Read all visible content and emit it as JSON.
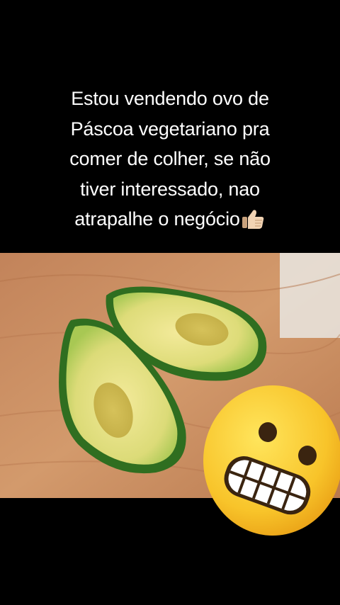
{
  "caption": {
    "line1": "Estou vendendo ovo de",
    "line2": "Páscoa vegetariano pra",
    "line3": "comer de colher, se não",
    "line4": "tiver interessado, nao",
    "line5": "atrapalhe o negócio",
    "trailing_emoji": "thumbs-up-icon"
  },
  "photo": {
    "subject": "avocado-halves-on-cutting-board"
  },
  "overlay_emoji": "grimacing-face-icon",
  "colors": {
    "background": "#000000",
    "text": "#ffffff",
    "board": "#c78a5a",
    "avocado_skin": "#3f8a2c",
    "avocado_flesh": "#e8e07a"
  }
}
